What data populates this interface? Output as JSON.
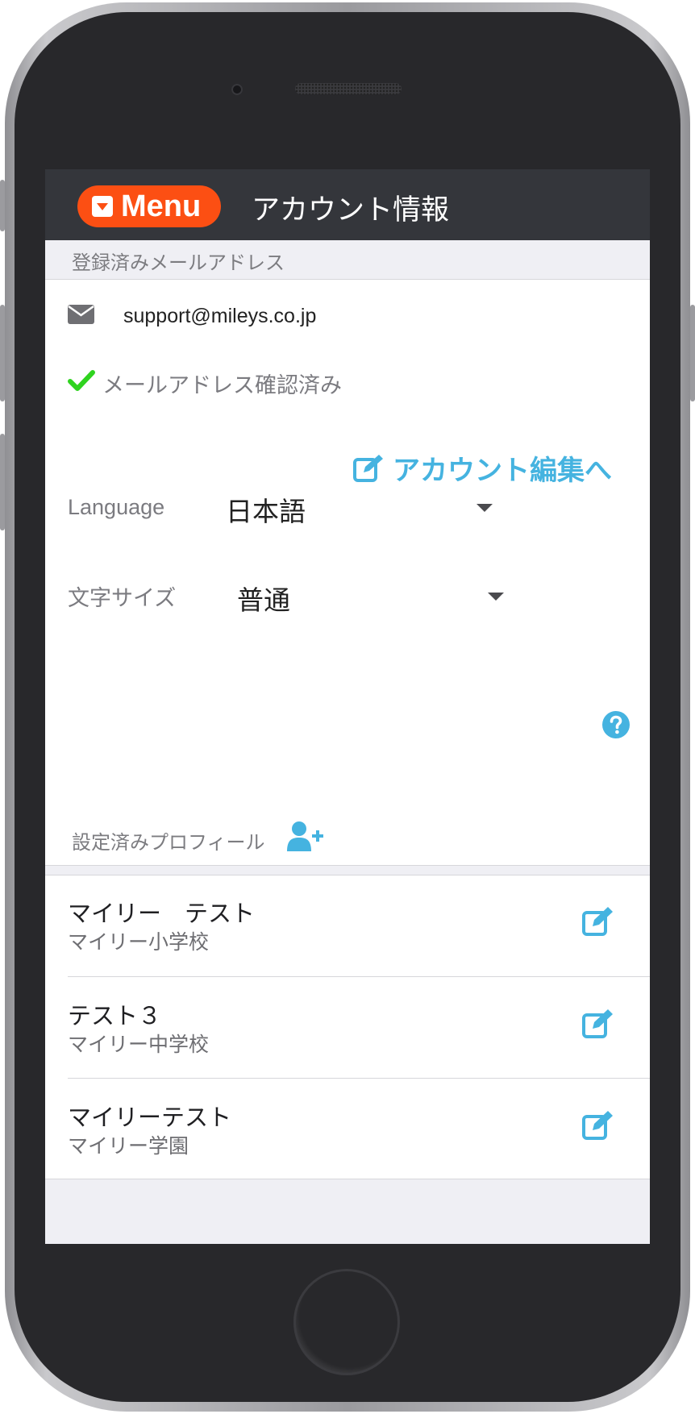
{
  "header": {
    "menu_label": "Menu",
    "title": "アカウント情報"
  },
  "email_section": {
    "label": "登録済みメールアドレス",
    "email": "support@mileys.co.jp",
    "verified_text": "メールアドレス確認済み",
    "edit_account_link": "アカウント編集へ"
  },
  "settings": {
    "language_label": "Language",
    "language_value": "日本語",
    "font_size_label": "文字サイズ",
    "font_size_value": "普通"
  },
  "profiles_section": {
    "label": "設定済みプロフィール",
    "profiles": [
      {
        "name": "マイリー　テスト",
        "school": "マイリー小学校"
      },
      {
        "name": "テスト３",
        "school": "マイリー中学校"
      },
      {
        "name": "マイリーテスト",
        "school": "マイリー学園"
      }
    ]
  },
  "colors": {
    "accent_orange": "#fc4f13",
    "link_blue": "#45b3e0",
    "check_green": "#2fd31f",
    "header_bg": "#34363b"
  },
  "icons": [
    "chevron-down-icon",
    "mail-icon",
    "check-icon",
    "edit-icon",
    "help-icon",
    "add-user-icon"
  ]
}
